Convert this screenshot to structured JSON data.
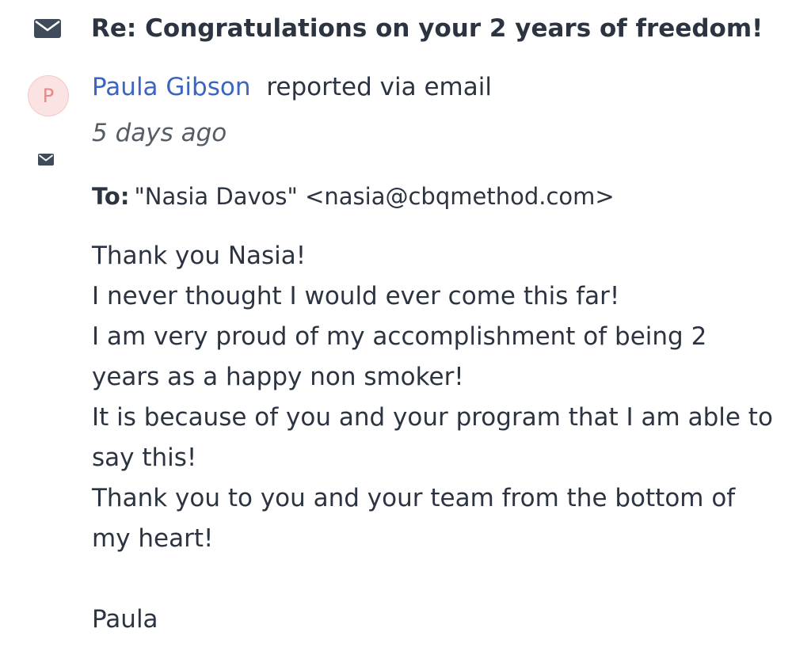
{
  "icons": {
    "header": "envelope-icon",
    "small": "envelope-icon"
  },
  "colors": {
    "text": "#2b3440",
    "link": "#3a66c2",
    "muted": "#555d66",
    "avatar_bg": "#fbe3e3",
    "avatar_text": "#e08a8a"
  },
  "message": {
    "subject": "Re: Congratulations on your 2 years of freedom!",
    "avatar_initial": "P",
    "author_name": "Paula Gibson",
    "reported_text": "reported via email",
    "timestamp": "5 days ago",
    "to_label": "To:",
    "to_value": "\"Nasia Davos\" <nasia@cbqmethod.com>",
    "body_lines": [
      "Thank you Nasia!",
      "I never thought I would ever come this far!",
      "I am very proud of my accomplishment of being 2",
      "years as a happy non smoker!",
      "It is because of you and your program that I am able to",
      "say this!",
      "Thank you to you and your team from the bottom of",
      "my heart!"
    ],
    "signature": "Paula"
  }
}
